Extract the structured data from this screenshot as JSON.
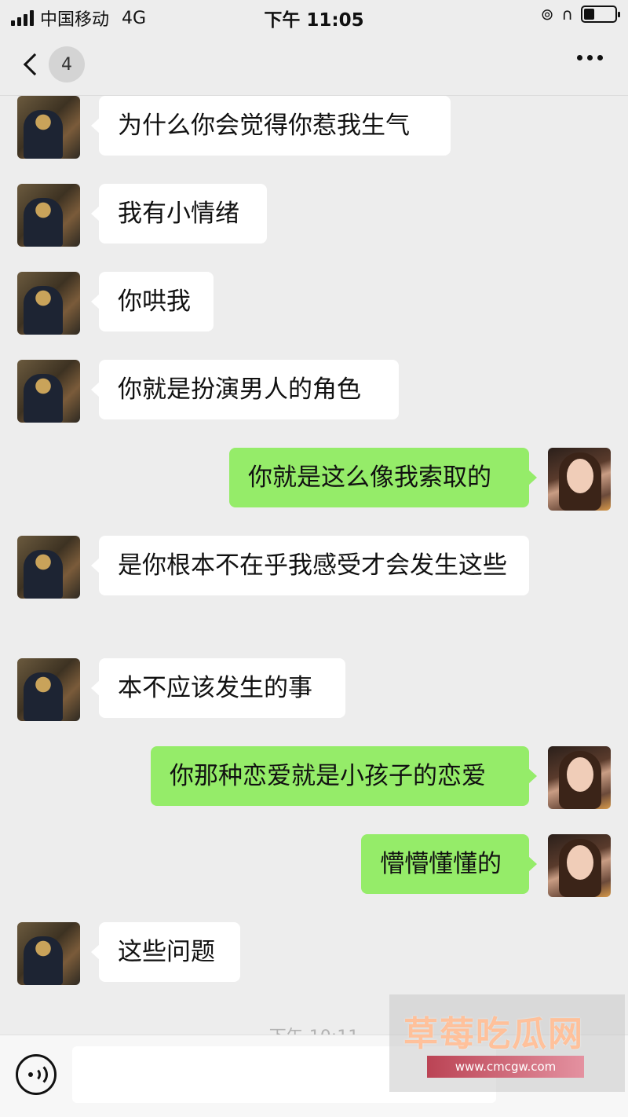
{
  "status_bar": {
    "carrier": "中国移动",
    "network": "4G",
    "time": "下午 11:05",
    "battery_level": 0.35
  },
  "nav": {
    "back_icon": "chevron-left-icon",
    "unread_count": "4",
    "more_icon": "more-dots-icon"
  },
  "messages": [
    {
      "side": "left",
      "text": "为什么你会觉得你惹我生气"
    },
    {
      "side": "left",
      "text": "我有小情绪"
    },
    {
      "side": "left",
      "text": "你哄我"
    },
    {
      "side": "left",
      "text": "你就是扮演男人的角色"
    },
    {
      "side": "right",
      "text": "你就是这么像我索取的"
    },
    {
      "side": "left",
      "text": "是你根本不在乎我感受才会发生这些"
    },
    {
      "side": "left",
      "text": "本不应该发生的事"
    },
    {
      "side": "right",
      "text": "你那种恋爱就是小孩子的恋爱"
    },
    {
      "side": "right",
      "text": "懵懵懂懂的"
    },
    {
      "side": "left",
      "text": "这些问题"
    }
  ],
  "timestamp": "下午 10:11",
  "input_bar": {
    "voice_icon": "voice-icon",
    "value": ""
  },
  "watermark": {
    "logo_text": "草莓吃瓜网",
    "url": "www.cmcgw.com"
  },
  "colors": {
    "background": "#ededed",
    "bubble_left": "#ffffff",
    "bubble_right": "#95ec69"
  }
}
